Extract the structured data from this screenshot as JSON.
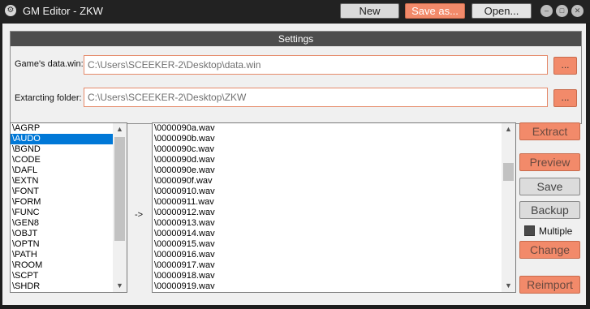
{
  "window": {
    "title": "GM Editor - ZKW",
    "icon": "gear-icon",
    "toolbar": {
      "new_label": "New",
      "save_as_label": "Save as...",
      "open_label": "Open..."
    },
    "controls": {
      "minimize_icon": "minimize-icon",
      "maximize_icon": "maximize-icon",
      "close_icon": "close-icon"
    }
  },
  "settings": {
    "title": "Settings",
    "data_win": {
      "label": "Game's data.win:",
      "value": "C:\\Users\\SCEEKER-2\\Desktop\\data.win",
      "browse_label": "..."
    },
    "extract_folder": {
      "label": "Extarcting folder:",
      "value": "C:\\Users\\SCEEKER-2\\Desktop\\ZKW",
      "browse_label": "..."
    }
  },
  "chunk_list": {
    "selected": "\\AUDO",
    "items": [
      "\\AGRP",
      "\\AUDO",
      "\\BGND",
      "\\CODE",
      "\\DAFL",
      "\\EXTN",
      "\\FONT",
      "\\FORM",
      "\\FUNC",
      "\\GEN8",
      "\\OBJT",
      "\\OPTN",
      "\\PATH",
      "\\ROOM",
      "\\SCPT",
      "\\SHDR"
    ]
  },
  "arrow_label": "->",
  "file_list": {
    "items": [
      "\\0000090a.wav",
      "\\0000090b.wav",
      "\\0000090c.wav",
      "\\0000090d.wav",
      "\\0000090e.wav",
      "\\0000090f.wav",
      "\\00000910.wav",
      "\\00000911.wav",
      "\\00000912.wav",
      "\\00000913.wav",
      "\\00000914.wav",
      "\\00000915.wav",
      "\\00000916.wav",
      "\\00000917.wav",
      "\\00000918.wav",
      "\\00000919.wav"
    ]
  },
  "actions": {
    "extract_label": "Extract",
    "preview_label": "Preview",
    "save_label": "Save",
    "backup_label": "Backup",
    "multiple_label": "Multiple",
    "change_label": "Change",
    "reimport_label": "Reimport"
  },
  "colors": {
    "accent": "#f28a6a",
    "title_bar": "#222222",
    "selection": "#0078d7"
  }
}
